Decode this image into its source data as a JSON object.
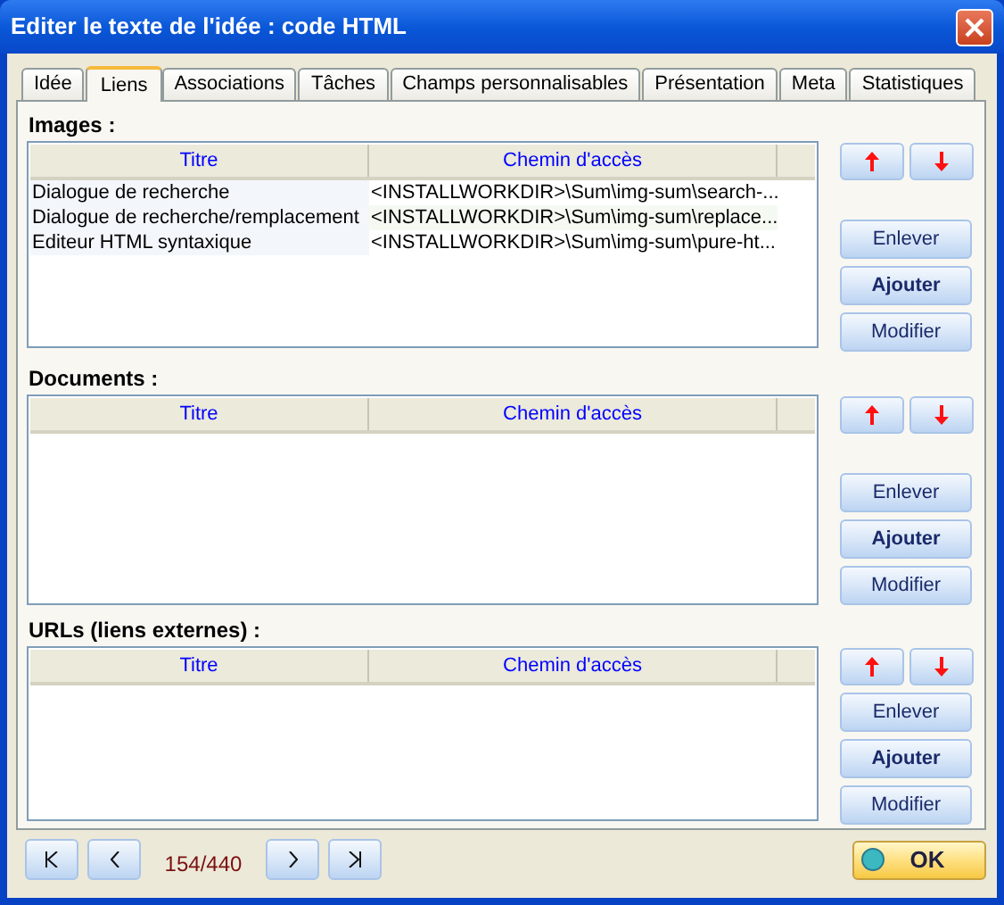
{
  "window": {
    "title": "Editer le texte de l'idée : code HTML"
  },
  "tabs": [
    {
      "label": "Idée",
      "selected": false
    },
    {
      "label": "Liens",
      "selected": true
    },
    {
      "label": "Associations",
      "selected": false
    },
    {
      "label": "Tâches",
      "selected": false
    },
    {
      "label": "Champs personnalisables",
      "selected": false
    },
    {
      "label": "Présentation",
      "selected": false
    },
    {
      "label": "Meta",
      "selected": false
    },
    {
      "label": "Statistiques",
      "selected": false
    }
  ],
  "sections": [
    {
      "label": "Images :",
      "columns": [
        "Titre",
        "Chemin d'accès"
      ],
      "rows": [
        [
          "Dialogue de recherche",
          "<INSTALLWORKDIR>\\Sum\\img-sum\\search-..."
        ],
        [
          "Dialogue de recherche/remplacement",
          "<INSTALLWORKDIR>\\Sum\\img-sum\\replace..."
        ],
        [
          "Editeur HTML syntaxique",
          "<INSTALLWORKDIR>\\Sum\\img-sum\\pure-ht..."
        ]
      ],
      "buttons": [
        {
          "label": "Enlever",
          "default": false
        },
        {
          "label": "Ajouter",
          "default": true
        },
        {
          "label": "Modifier",
          "default": false
        }
      ]
    },
    {
      "label": "Documents :",
      "columns": [
        "Titre",
        "Chemin d'accès"
      ],
      "buttons": [
        {
          "label": "Enlever",
          "default": false
        },
        {
          "label": "Ajouter",
          "default": true
        },
        {
          "label": "Modifier",
          "default": false
        }
      ]
    },
    {
      "label": "URLs (liens externes) :",
      "columns": [
        "Titre",
        "Chemin d'accès"
      ],
      "buttons": [
        {
          "label": "Enlever",
          "default": false
        },
        {
          "label": "Ajouter",
          "default": true
        },
        {
          "label": "Modifier",
          "default": false
        }
      ]
    }
  ],
  "navigation": {
    "counter": "154/440"
  },
  "ok_button": {
    "label": "OK"
  }
}
